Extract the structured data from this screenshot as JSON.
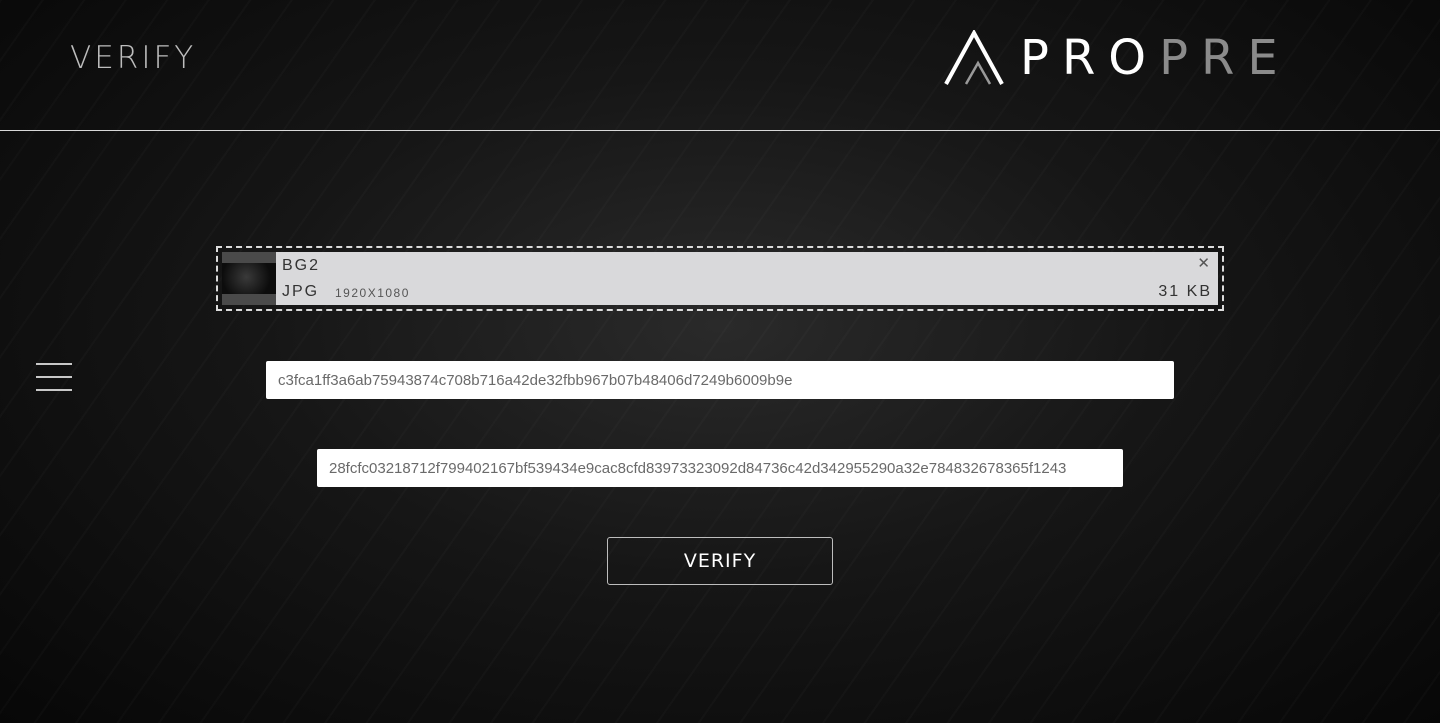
{
  "header": {
    "title": "VERIFY",
    "logo": {
      "part1": "PRO",
      "part2": "PRE",
      "part1_color": "#ffffff",
      "part2_color": "#8b8b8b"
    }
  },
  "nav": {
    "menu_icon": "hamburger-menu-icon"
  },
  "upload": {
    "file_name": "BG2",
    "file_type": "JPG",
    "dimensions": "1920X1080",
    "file_size": "31 KB",
    "remove_icon": "close-icon"
  },
  "form": {
    "hash_input_1": {
      "value": "c3fca1ff3a6ab75943874c708b716a42de32fbb967b07b48406d7249b6009b9e"
    },
    "hash_input_2": {
      "value": "28fcfc03218712f799402167bf539434e9cac8cfd83973323092d84736c42d342955290a32e784832678365f1243"
    },
    "verify_button": "VERIFY"
  },
  "colors": {
    "background": "#0a0a0a",
    "card": "#d9d9db",
    "text": "#ffffff",
    "muted": "#bdbdbd"
  }
}
